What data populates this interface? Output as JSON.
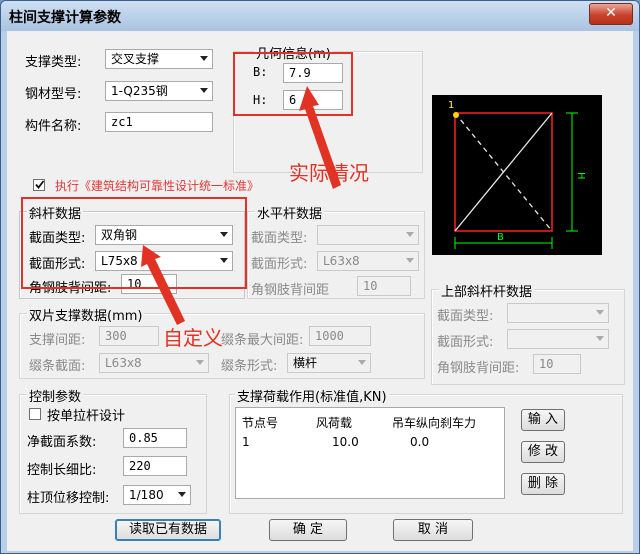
{
  "window": {
    "title": "柱间支撑计算参数",
    "close_glyph": "✕"
  },
  "basic": {
    "support_type": {
      "label": "支撑类型:",
      "value": "交叉支撑"
    },
    "steel_grade": {
      "label": "钢材型号:",
      "value": "1-Q235钢"
    },
    "member_name": {
      "label": "构件名称:",
      "value": "zc1"
    }
  },
  "geometry": {
    "title": "几何信息(m)",
    "b": {
      "label": "B:",
      "value": "7.9"
    },
    "h": {
      "label": "H:",
      "value": "6"
    }
  },
  "code_check": {
    "label": "执行《建筑结构可靠性设计统一标准》",
    "checked": true
  },
  "diagonal": {
    "title": "斜杆数据",
    "section_type": {
      "label": "截面类型:",
      "value": "双角钢"
    },
    "section_form": {
      "label": "截面形式:",
      "value": "L75x8"
    },
    "angle_spacing": {
      "label": "角钢肢背间距:",
      "value": "10"
    }
  },
  "horizontal": {
    "title": "水平杆数据",
    "section_type": {
      "label": "截面类型:",
      "value": ""
    },
    "section_form": {
      "label": "截面形式:",
      "value": "L63x8"
    },
    "angle_spacing": {
      "label": "角钢肢背间距",
      "value": "10"
    }
  },
  "upper_diagonal": {
    "title": "上部斜杆杆数据",
    "section_type": {
      "label": "截面类型:",
      "value": ""
    },
    "section_form": {
      "label": "截面形式:",
      "value": ""
    },
    "angle_spacing": {
      "label": "角钢肢背间距:",
      "value": "10"
    }
  },
  "double": {
    "title": "双片支撑数据(mm)",
    "support_spacing": {
      "label": "支撑间距:",
      "value": "300"
    },
    "lacing_max_spacing": {
      "label": "缀条最大间距:",
      "value": "1000"
    },
    "lacing_section": {
      "label": "缀条截面:",
      "value": "L63x8"
    },
    "lacing_form": {
      "label": "缀条形式:",
      "value": "横杆"
    }
  },
  "control": {
    "title": "控制参数",
    "tension_only": {
      "label": "按单拉杆设计",
      "checked": false
    },
    "net_section": {
      "label": "净截面系数:",
      "value": "0.85"
    },
    "slenderness": {
      "label": "控制长细比:",
      "value": "220"
    },
    "top_disp": {
      "label": "柱顶位移控制:",
      "value": "1/180"
    }
  },
  "loads": {
    "title": "支撑荷载作用(标准值,KN)",
    "columns": [
      "节点号",
      "风荷载",
      "吊车纵向刹车力"
    ],
    "rows": [
      [
        "1",
        "10.0",
        "0.0"
      ]
    ],
    "buttons": {
      "input": "输 入",
      "modify": "修 改",
      "delete": "删 除"
    }
  },
  "footer": {
    "read": "读取已有数据",
    "ok": "确 定",
    "cancel": "取 消"
  },
  "diagram": {
    "node_label": "1",
    "b_label": "B",
    "h_label": "H"
  },
  "annotations": {
    "actual": "实际情况",
    "custom": "自定义"
  },
  "colors": {
    "annotation": "#e13224",
    "diagram_bg": "#000000",
    "dimension": "#00ff00",
    "frame": "#ff2020"
  }
}
